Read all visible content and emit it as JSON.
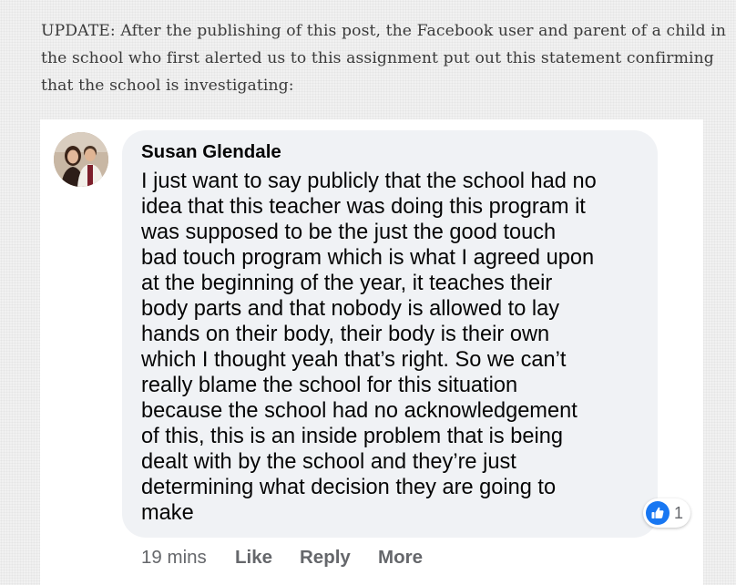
{
  "article": {
    "update_lines": [
      "UPDATE: After the publishing of this post, the Facebook user and parent of a child in",
      "the school who first alerted us to this assignment put out this statement confirming",
      "that the school is investigating:"
    ]
  },
  "comment": {
    "author": "Susan Glendale",
    "body_lines": [
      "I just want to say publicly that the school had no",
      "idea that this teacher was doing this program it",
      "was supposed to be the just the good touch",
      "bad touch program which is what I agreed upon",
      "at the beginning of the year, it teaches their",
      "body parts and that nobody is allowed to lay",
      "hands on their body, their body is their own",
      "which I thought yeah that’s right. So we can’t",
      "really blame the school for this situation",
      "because the school had no acknowledgement",
      "of this, this is an inside problem that is being",
      "dealt with by the school and they’re just",
      "determining what decision they are going to",
      "make"
    ],
    "reaction_icon": "like-thumbs-up-icon",
    "reaction_count": "1",
    "timestamp": "19 mins",
    "actions": {
      "like": "Like",
      "reply": "Reply",
      "more": "More"
    }
  },
  "colors": {
    "background": "#f1f1f1",
    "bubble": "#f0f2f5",
    "facebook_blue": "#1877f2",
    "meta_text": "#65676b",
    "article_text": "#3a3a3a"
  }
}
